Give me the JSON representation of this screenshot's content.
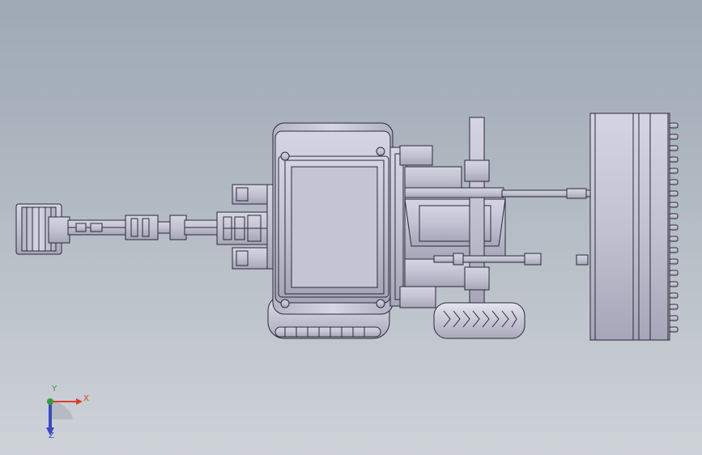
{
  "viewport": {
    "background_top": "#9ea9b4",
    "background_bottom": "#cfd3d8"
  },
  "model": {
    "parts": [
      "excavator-bucket",
      "excavator-boom",
      "stabilizer-legs",
      "rear-body",
      "engine-hood",
      "rear-wheel",
      "rear-chassis",
      "front-wheel",
      "lift-arm",
      "loader-bucket-teeth"
    ],
    "fill_color": "#c4c4d4",
    "edge_color": "#2a2a38"
  },
  "triad": {
    "x_label": "X",
    "y_label": "Y",
    "z_label": "Z",
    "x_color": "#e03c2c",
    "y_color": "#2e9e3a",
    "z_color": "#3a48c8"
  }
}
